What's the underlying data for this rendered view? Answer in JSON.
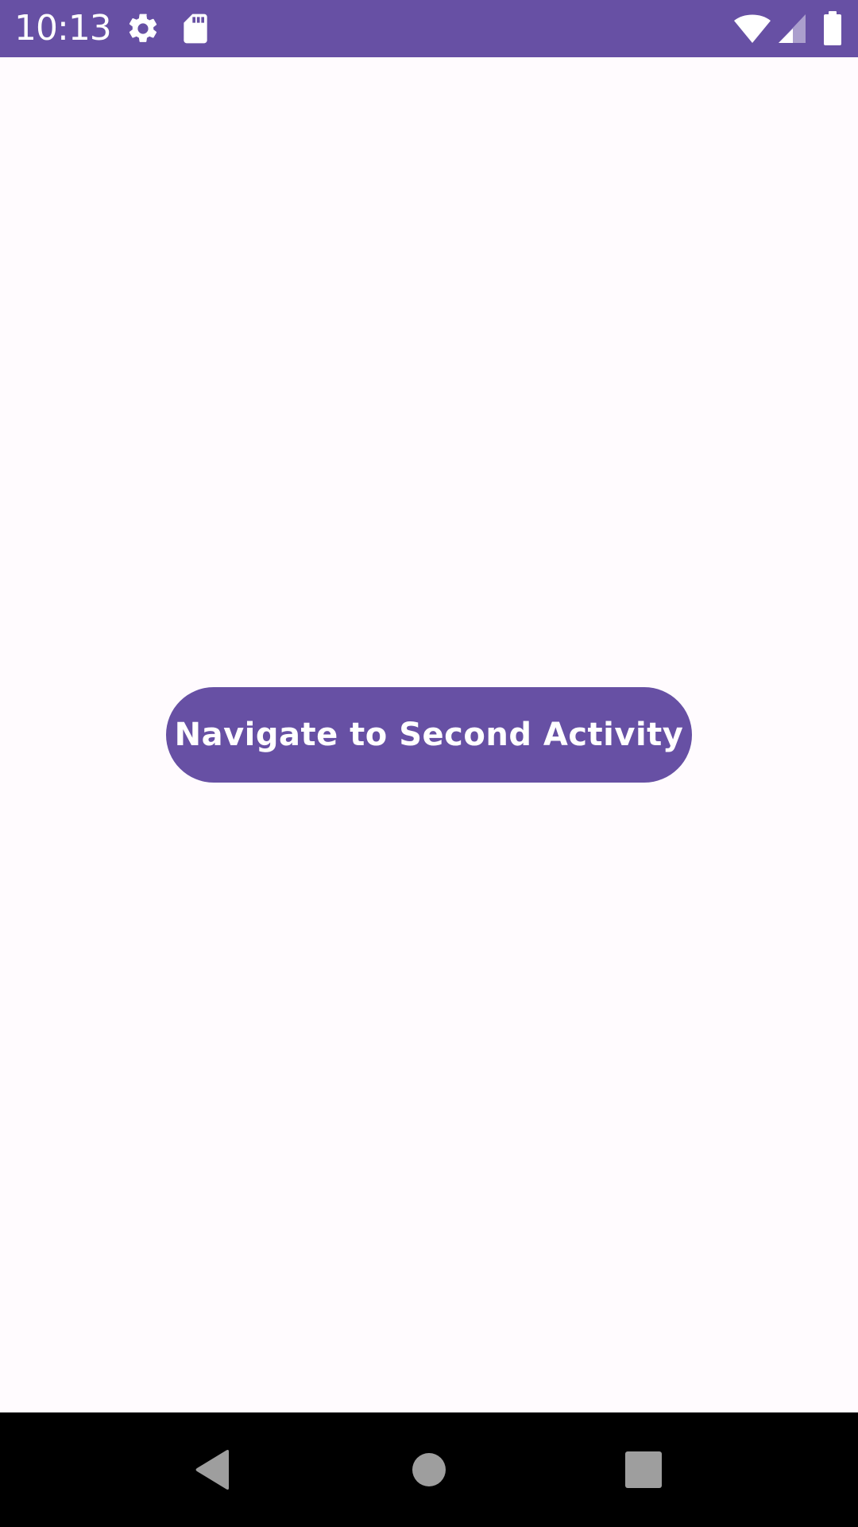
{
  "status_bar": {
    "time": "10:13",
    "background": "#6750a4",
    "icons": [
      "gear-icon",
      "sd-card-icon",
      "wifi-icon",
      "cell-signal-icon",
      "battery-icon"
    ]
  },
  "main": {
    "navigate_button_label": "Navigate to Second Activity",
    "button_color": "#6750a4",
    "background": "#fffbfe"
  },
  "nav_bar": {
    "background": "#000000",
    "icons": [
      "back-icon",
      "home-icon",
      "recents-icon"
    ],
    "icon_color": "#9e9e9e"
  }
}
